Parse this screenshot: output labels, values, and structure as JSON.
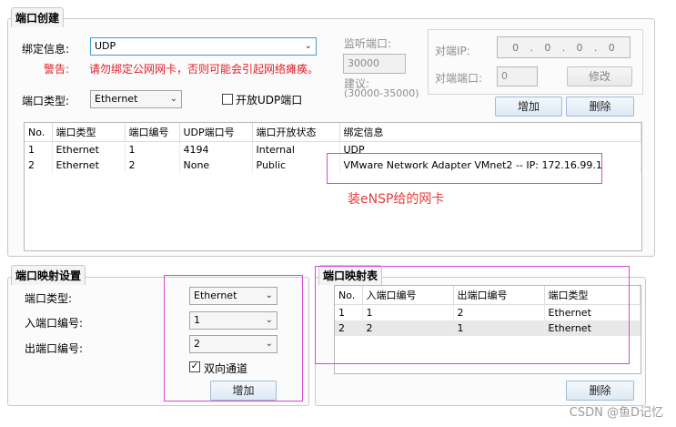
{
  "port_create": {
    "title": "端口创建",
    "bind_label": "绑定信息:",
    "bind_value": "UDP",
    "warn_label": "警告:",
    "warn_text": "请勿绑定公网网卡，否则可能会引起网络瘫痪。",
    "port_type_label": "端口类型:",
    "port_type_value": "Ethernet",
    "open_udp_label": "开放UDP端口",
    "listen_label": "监听端口:",
    "listen_value": "30000",
    "suggest_label": "建议:",
    "suggest_range": "(30000-35000)",
    "peer_ip_label": "对端IP:",
    "peer_ip_octets": [
      "0",
      "0",
      "0",
      "0"
    ],
    "peer_port_label": "对端端口:",
    "peer_port_value": "0",
    "modify_button": "修改",
    "add_button": "增加",
    "delete_button": "删除",
    "table": {
      "headers": [
        "No.",
        "端口类型",
        "端口编号",
        "UDP端口号",
        "端口开放状态",
        "绑定信息"
      ],
      "rows": [
        [
          "1",
          "Ethernet",
          "1",
          "4194",
          "Internal",
          "UDP"
        ],
        [
          "2",
          "Ethernet",
          "2",
          "None",
          "Public",
          "VMware Network Adapter VMnet2 -- IP: 172.16.99.1"
        ]
      ]
    },
    "annotation": "装eNSP给的网卡"
  },
  "port_mapping_settings": {
    "title": "端口映射设置",
    "port_type_label": "端口类型:",
    "port_type_value": "Ethernet",
    "in_port_label": "入端口编号:",
    "in_port_value": "1",
    "out_port_label": "出端口编号:",
    "out_port_value": "2",
    "bidirectional_label": "双向通道",
    "bidirectional_checked": true,
    "add_button": "增加"
  },
  "port_mapping_table": {
    "title": "端口映射表",
    "headers": [
      "No.",
      "入端口编号",
      "出端口编号",
      "端口类型"
    ],
    "rows": [
      [
        "1",
        "1",
        "2",
        "Ethernet"
      ],
      [
        "2",
        "2",
        "1",
        "Ethernet"
      ]
    ],
    "delete_button": "删除"
  },
  "watermark": "CSDN @鱼D记忆",
  "colors": {
    "annotation_magenta": "#d44bd2",
    "warning_red": "#e0202a",
    "focus_blue": "#3d9dd6"
  }
}
